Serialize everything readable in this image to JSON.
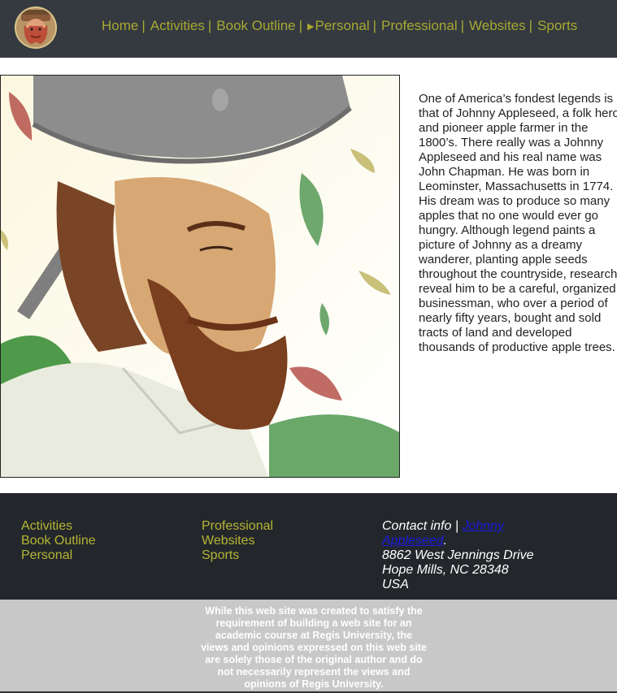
{
  "nav": {
    "items": [
      {
        "label": "Home",
        "sep": "|"
      },
      {
        "label": "Activities",
        "sep": "|"
      },
      {
        "label": "Book Outline",
        "sep": "|"
      },
      {
        "label": "Personal",
        "sep": "|",
        "arrow": "▶"
      },
      {
        "label": "Professional",
        "sep": "|"
      },
      {
        "label": "Websites",
        "sep": "|"
      },
      {
        "label": "Sports",
        "sep": ""
      }
    ]
  },
  "main": {
    "story": "One of America’s fondest legends is that of Johnny Appleseed, a folk hero and pioneer apple farmer in the 1800’s. There really was a Johnny Appleseed and his real name was John Chapman. He was born in Leominster, Massachusetts in 1774. His dream was to produce so many apples that no one would ever go hungry. Although legend paints a picture of Johnny as a dreamy wanderer, planting apple seeds throughout the countryside, research reveal him to be a careful, organized businessman, who over a period of nearly fifty years, bought and sold tracts of land and developed thousands of productive apple trees."
  },
  "footer": {
    "col1": [
      "Activities",
      "Book Outline",
      "Personal"
    ],
    "col2": [
      "Professional",
      "Websites",
      "Sports"
    ],
    "contact": {
      "label": "Contact info |",
      "link": "Johnny Appleseed",
      "period": ".",
      "address1": "8862 West Jennings Drive",
      "address2": "Hope Mills, NC 28348",
      "country": "USA"
    },
    "disclaimer": "While this web site was created to satisfy the requirement of building a web site for an academic course at Regis University, the views and opinions expressed on this web site are solely those of the original author and do not necessarily represent the views and opinions of Regis University."
  },
  "colors": {
    "header_bg": "#343a40",
    "nav_link": "#a8a830",
    "footer_bg": "#23272b",
    "footer_link": "#b5b535",
    "contact_link": "#1a1adc",
    "disclaimer_bg": "#c8c8c8"
  }
}
